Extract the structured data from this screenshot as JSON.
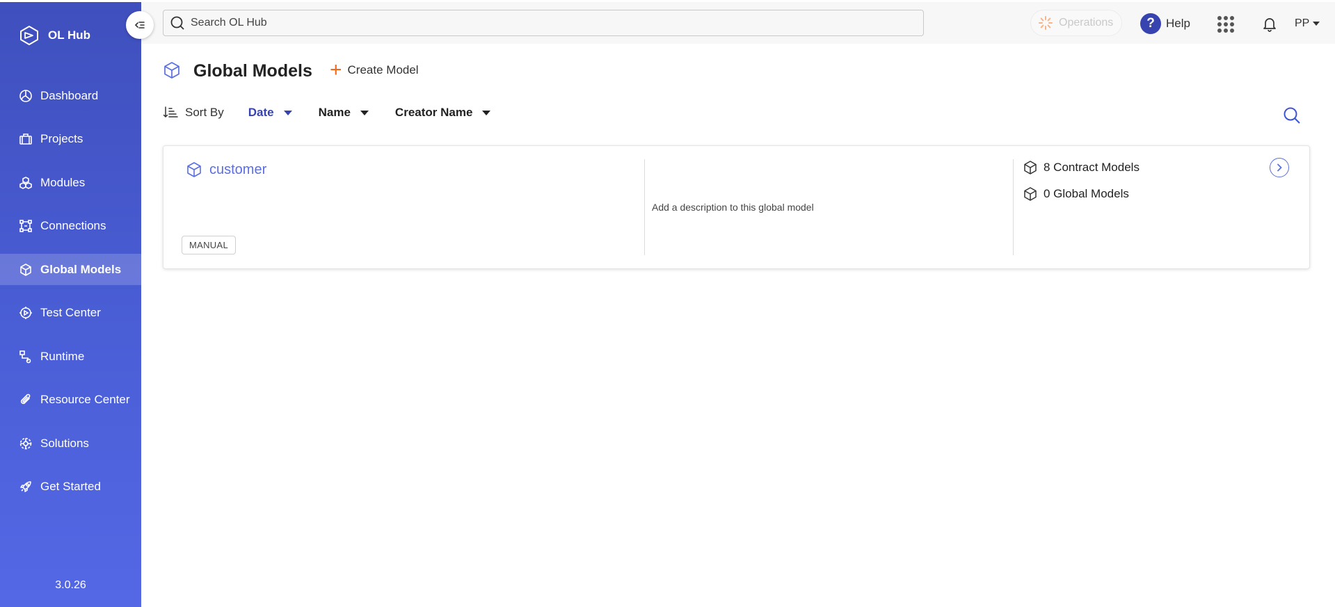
{
  "app": {
    "name": "OL Hub",
    "version": "3.0.26"
  },
  "sidebar": {
    "items": [
      {
        "label": "Dashboard",
        "icon": "dashboard-icon"
      },
      {
        "label": "Projects",
        "icon": "briefcase-icon"
      },
      {
        "label": "Modules",
        "icon": "modules-icon"
      },
      {
        "label": "Connections",
        "icon": "connections-icon"
      },
      {
        "label": "Global Models",
        "icon": "cube-icon",
        "active": true
      },
      {
        "label": "Test Center",
        "icon": "test-center-icon"
      },
      {
        "label": "Runtime",
        "icon": "runtime-icon"
      },
      {
        "label": "Resource Center",
        "icon": "paperclip-icon"
      },
      {
        "label": "Solutions",
        "icon": "solutions-icon"
      },
      {
        "label": "Get Started",
        "icon": "rocket-icon"
      }
    ]
  },
  "topbar": {
    "search_placeholder": "Search OL Hub",
    "operations_label": "Operations",
    "help_label": "Help",
    "user_initials": "PP"
  },
  "page": {
    "title": "Global Models",
    "create_label": "Create Model"
  },
  "sort": {
    "label": "Sort By",
    "options": [
      {
        "label": "Date",
        "active": true
      },
      {
        "label": "Name",
        "active": false
      },
      {
        "label": "Creator Name",
        "active": false
      }
    ]
  },
  "models": [
    {
      "name": "customer",
      "badge": "MANUAL",
      "description": "Add a description to this global model",
      "contract_models": "8 Contract Models",
      "global_models": "0 Global Models"
    }
  ],
  "colors": {
    "accent": "#3744b0",
    "link": "#5b6fe0",
    "create": "#f26a1b",
    "sidebar_top": "#3f4fbd",
    "sidebar_bottom": "#5468e6"
  }
}
